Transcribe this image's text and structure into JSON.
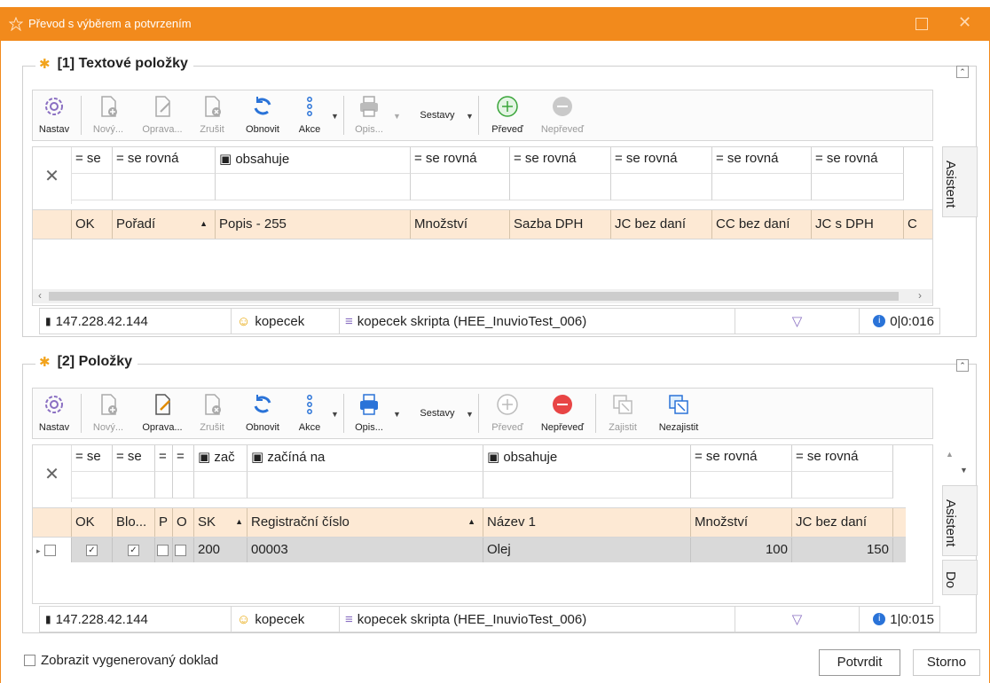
{
  "window": {
    "title": "Převod s výběrem a potvrzením"
  },
  "toolbar1": {
    "nastav": "Nastav",
    "novy": "Nový...",
    "oprava": "Oprava...",
    "zrusit": "Zrušit",
    "obnovit": "Obnovit",
    "akce": "Akce",
    "opis": "Opis...",
    "sestavy": "Sestavy",
    "preved": "Převeď",
    "neprevedt": "Nepřeveď"
  },
  "toolbar2": {
    "nastav": "Nastav",
    "novy": "Nový...",
    "oprava": "Oprava...",
    "zrusit": "Zrušit",
    "obnovit": "Obnovit",
    "akce": "Akce",
    "opis": "Opis...",
    "sestavy": "Sestavy",
    "preved": "Převeď",
    "neprevedt": "Nepřeveď",
    "zajistit": "Zajistit",
    "nezajistit": "Nezajistit"
  },
  "group1": {
    "title": "[1] Textové položky",
    "filters": [
      "= se",
      "= se rovná",
      "▣ obsahuje",
      "= se rovná",
      "= se rovná",
      "= se rovná",
      "= se rovná",
      "= se rovná"
    ],
    "columns": [
      "OK",
      "Pořadí",
      "Popis - 255",
      "Množství",
      "Sazba DPH",
      "JC bez daní",
      "CC bez daní",
      "JC s DPH",
      "C"
    ],
    "side_tab": "Asistent",
    "status": {
      "ip": "147.228.42.144",
      "user": "kopecek",
      "db": "kopecek skripta (HEE_InuvioTest_006)",
      "info": "0|0:016"
    }
  },
  "group2": {
    "title": "[2] Položky",
    "filters": [
      "= se",
      "= se",
      "=",
      "=",
      "▣ zač",
      "▣ začíná na",
      "▣ obsahuje",
      "= se rovná",
      "= se rovná"
    ],
    "columns": [
      "OK",
      "Blo...",
      "P",
      "O",
      "SK",
      "Registrační číslo",
      "Název 1",
      "Množství",
      "JC bez daní"
    ],
    "rows": [
      {
        "ok": "✓",
        "blo": "✓",
        "sk": "200",
        "reg": "00003",
        "nazev": "Olej",
        "mnozstvi": "100",
        "jc": "150"
      }
    ],
    "side_tab": "Asistent",
    "side_tab2": "Do",
    "status": {
      "ip": "147.228.42.144",
      "user": "kopecek",
      "db": "kopecek skripta (HEE_InuvioTest_006)",
      "info": "1|0:015"
    }
  },
  "footer": {
    "checkbox_label": "Zobrazit vygenerovaný doklad",
    "confirm": "Potvrdit",
    "cancel": "Storno"
  }
}
